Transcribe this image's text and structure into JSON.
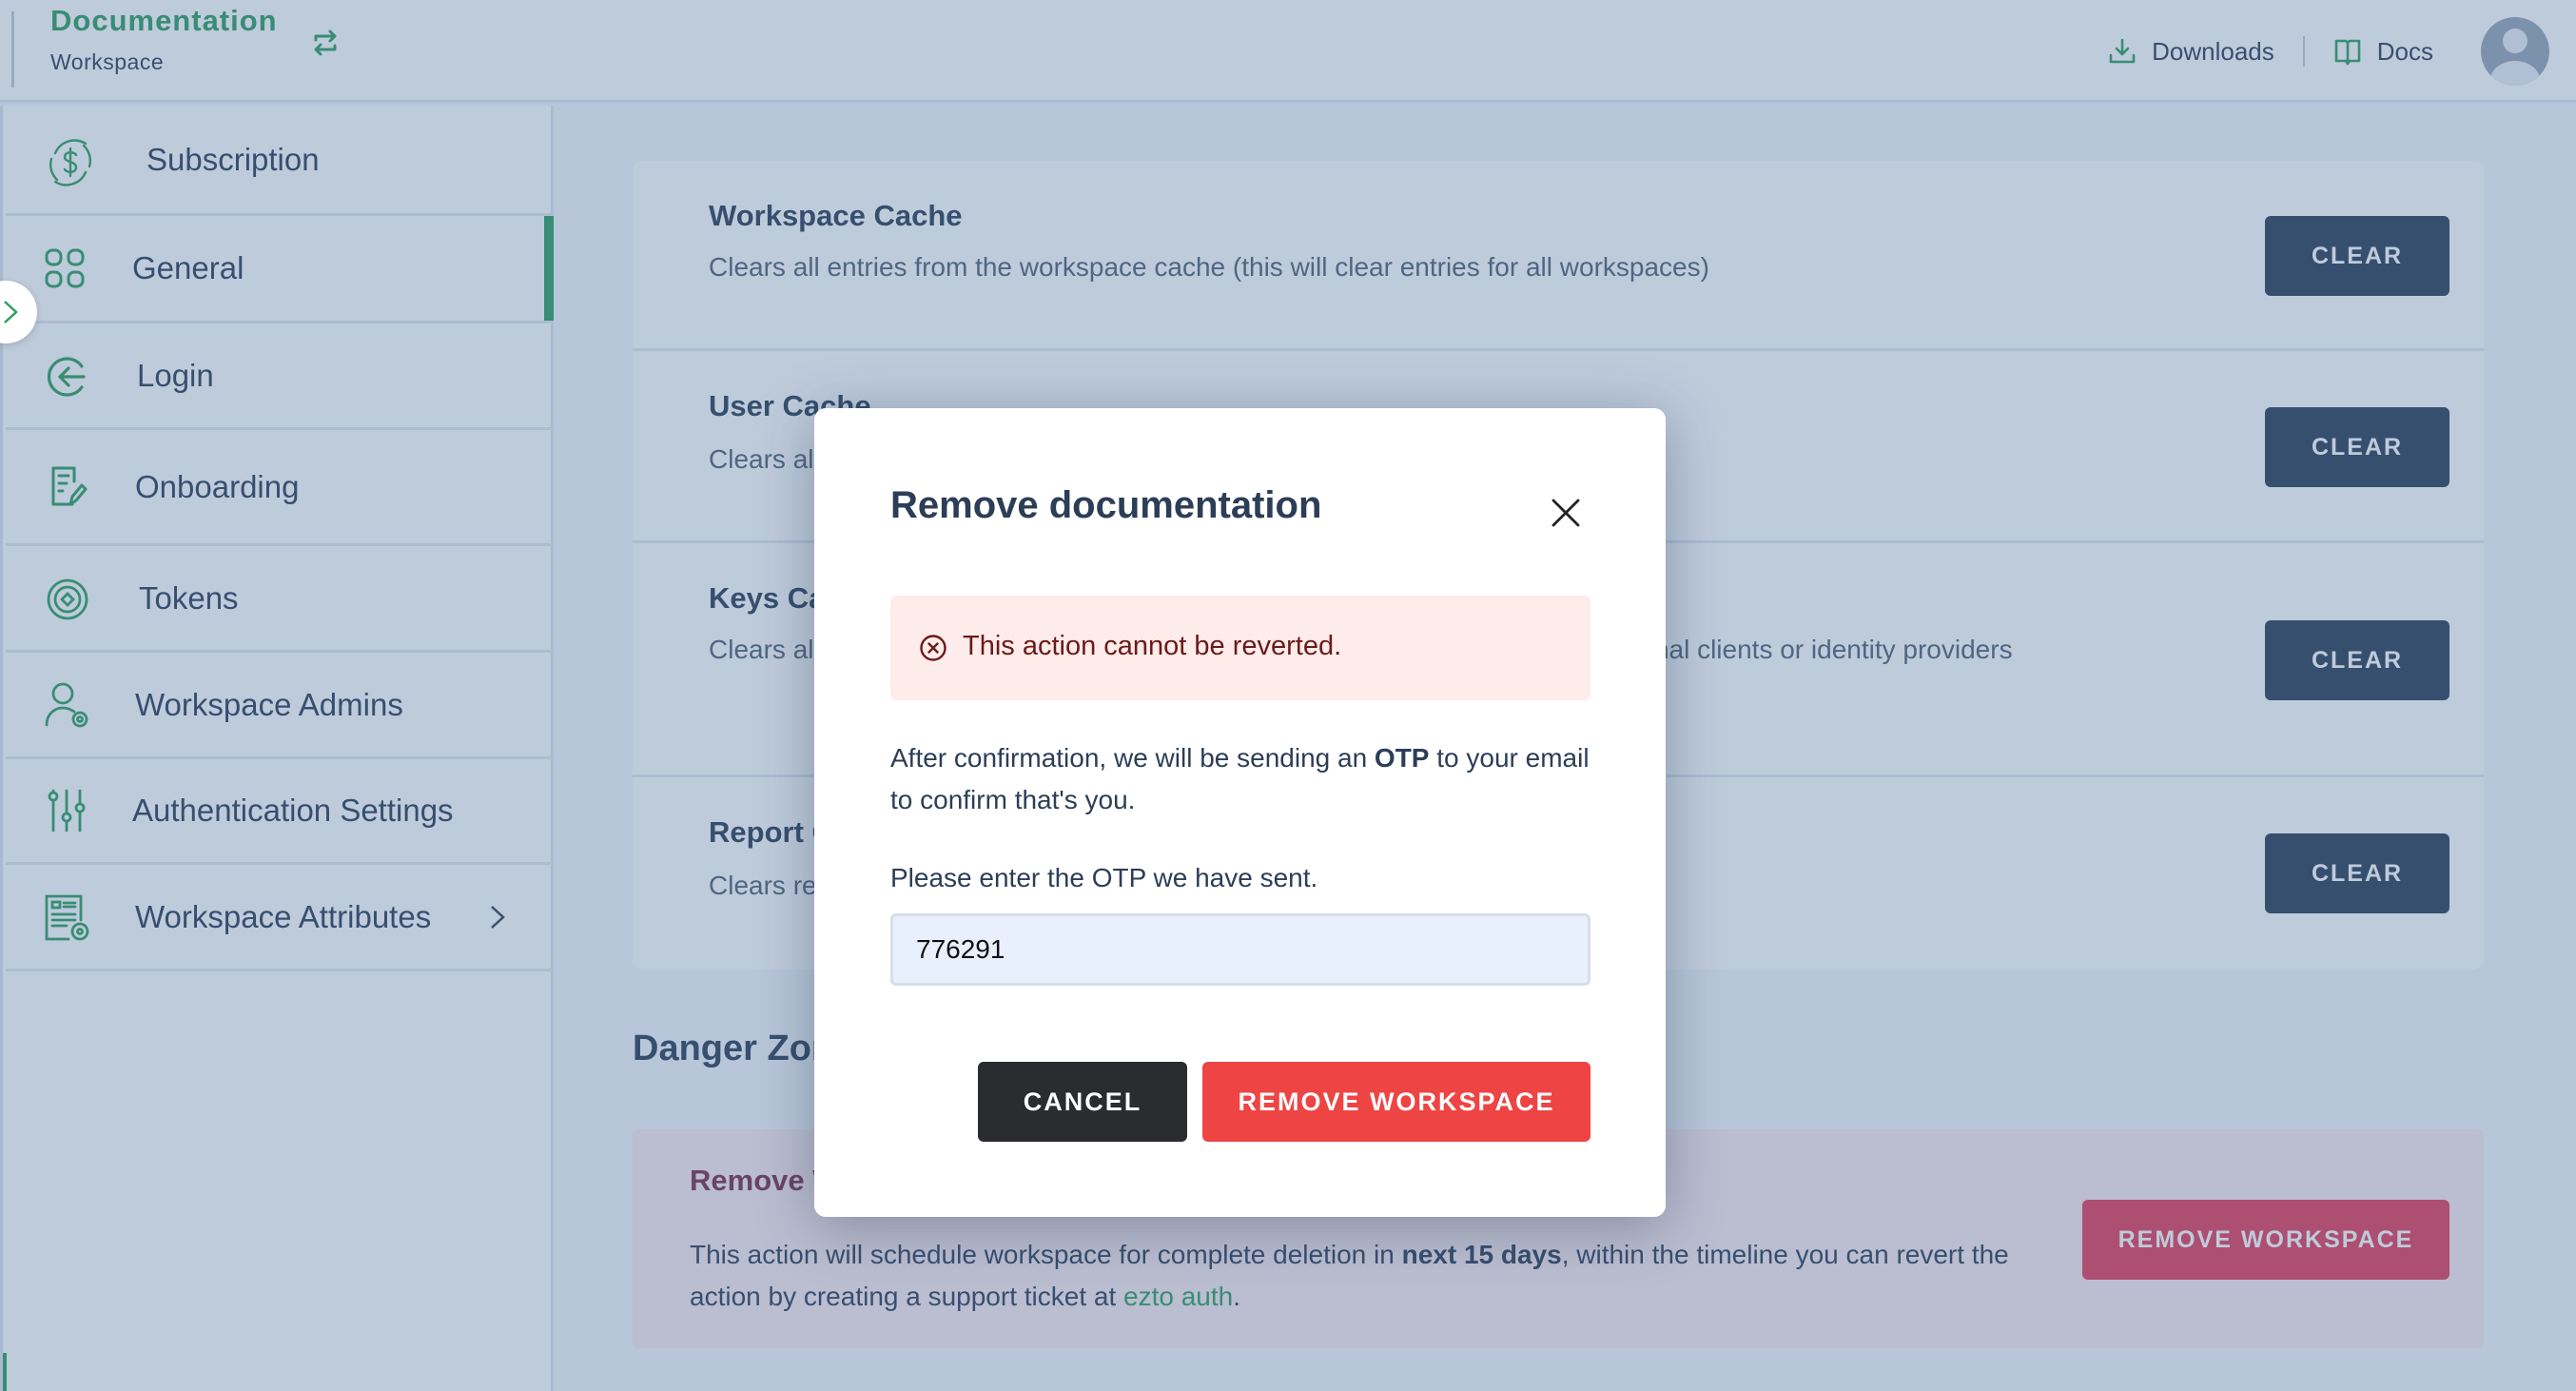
{
  "header": {
    "workspace_name": "Documentation",
    "workspace_label": "Workspace",
    "links": [
      {
        "label": "Downloads",
        "icon": "download-icon"
      },
      {
        "label": "Docs",
        "icon": "book-icon"
      }
    ],
    "avatar_icon": "user-avatar-icon"
  },
  "sidebar": {
    "items": [
      {
        "label": "Subscription",
        "icon": "dollar-cycle-icon",
        "active": false
      },
      {
        "label": "General",
        "icon": "grid-icon",
        "active": true
      },
      {
        "label": "Login",
        "icon": "login-arrow-icon",
        "active": false
      },
      {
        "label": "Onboarding",
        "icon": "document-edit-icon",
        "active": false
      },
      {
        "label": "Tokens",
        "icon": "token-icon",
        "active": false
      },
      {
        "label": "Workspace Admins",
        "icon": "user-gear-icon",
        "active": false
      },
      {
        "label": "Authentication Settings",
        "icon": "sliders-icon",
        "active": false
      },
      {
        "label": "Workspace Attributes",
        "icon": "form-gear-icon",
        "active": false,
        "has_submenu": true
      }
    ]
  },
  "main": {
    "cache_rows": [
      {
        "title": "Workspace Cache",
        "description": "Clears all entries from the workspace cache (this will clear entries for all workspaces)",
        "button": "CLEAR"
      },
      {
        "title": "User Cache",
        "description": "Clears all entries from the user cache (this will clear entries for all workspaces)",
        "button": "CLEAR"
      },
      {
        "title": "Keys Cache",
        "description": "Clears all entries from the cache of external public keys. These are keys of external clients or identity providers",
        "button": "CLEAR"
      },
      {
        "title": "Report Cache",
        "description": "Clears report cache entries",
        "button": "CLEAR"
      }
    ],
    "danger_zone": {
      "title": "Danger Zone",
      "item_title": "Remove Workspace",
      "description_pre": "This action will schedule workspace for complete deletion in ",
      "description_bold": "next 15 days",
      "description_mid": ", within the timeline you can revert the action by creating a support ticket at ",
      "link_text": "ezto auth",
      "description_post": ".",
      "button": "REMOVE WORKSPACE"
    }
  },
  "modal": {
    "title": "Remove documentation",
    "alert_text": "This action cannot be reverted.",
    "description_pre": "After confirmation, we will be sending an ",
    "description_bold": "OTP",
    "description_post": " to your email to confirm that's you.",
    "otp_label": "Please enter the OTP we have sent.",
    "otp_value": "776291",
    "cancel_label": "CANCEL",
    "confirm_label": "REMOVE WORKSPACE"
  },
  "colors": {
    "brand_green": "#2e9e5e",
    "danger_red": "#ef4444",
    "dark_button": "#2c3e57"
  }
}
